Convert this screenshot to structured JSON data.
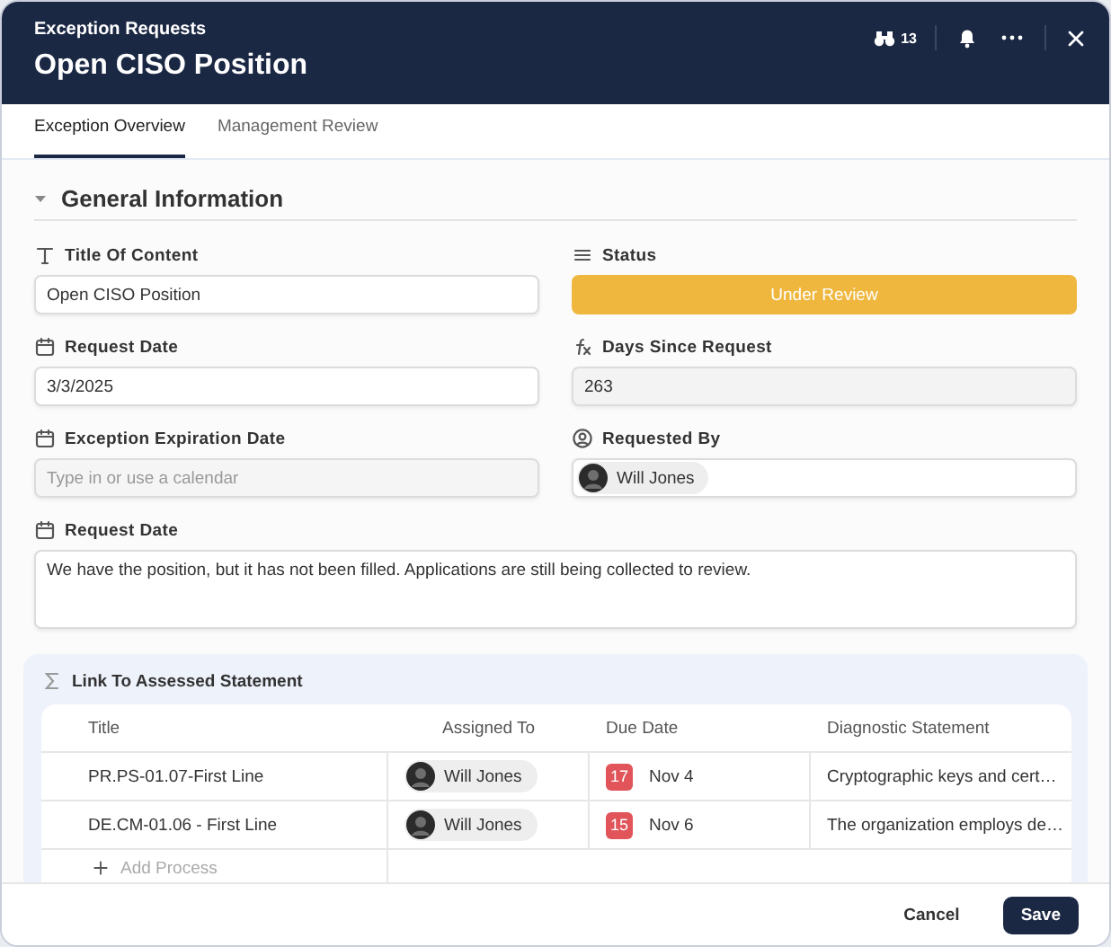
{
  "window": {
    "subtitle": "Exception Requests",
    "title": "Open CISO Position",
    "watchers": "13"
  },
  "tabs": [
    {
      "label": "Exception Overview",
      "selected": true
    },
    {
      "label": "Management Review",
      "selected": false
    }
  ],
  "section": {
    "title": "General Information",
    "expanded": true
  },
  "fields": [
    {
      "kind": "text",
      "label": "Title Of Content",
      "value": "Open CISO Position"
    },
    {
      "kind": "status",
      "label": "Status",
      "value": "Under Review"
    },
    {
      "kind": "date",
      "label": "Request Date",
      "value": "3/3/2025"
    },
    {
      "kind": "formula",
      "label": "Days Since Request",
      "value": "263"
    },
    {
      "kind": "date",
      "label": "Exception Expiration Date",
      "placeholder": "Type in or use a calendar"
    },
    {
      "kind": "person",
      "label": "Requested By",
      "value": "Will Jones"
    },
    {
      "kind": "textarea",
      "label": "Request Date",
      "value": "We have the position, but it has not been filled. Applications are still being collected to review."
    }
  ],
  "linked": {
    "title": "Link To Assessed Statement",
    "columns": [
      "Title",
      "Assigned To",
      "Due Date",
      "Diagnostic Statement"
    ],
    "rows": [
      {
        "title": "PR.PS-01.07-First Line",
        "assignee": "Will Jones",
        "day": "17",
        "due": "Nov 4",
        "statement": "Cryptographic keys and cert…"
      },
      {
        "title": "DE.CM-01.06 - First Line",
        "assignee": "Will Jones",
        "day": "15",
        "due": "Nov 6",
        "statement": "The organization employs de…"
      }
    ],
    "add_label": "Add Process"
  },
  "buttons": [
    {
      "label": "Cancel",
      "kind": "secondary"
    },
    {
      "label": "Save",
      "kind": "primary"
    }
  ]
}
